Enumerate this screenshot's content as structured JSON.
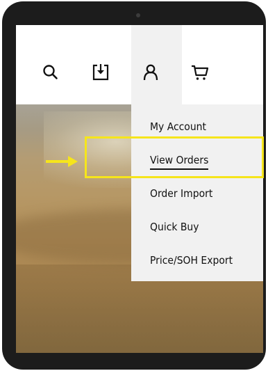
{
  "colors": {
    "accent_yellow": "#f6e51b",
    "menu_background": "#f1f1f1",
    "text": "#111111",
    "device_frame": "#1c1c1c"
  },
  "header": {
    "icons": [
      {
        "name": "search-icon"
      },
      {
        "name": "download-icon"
      },
      {
        "name": "user-icon"
      },
      {
        "name": "cart-icon"
      }
    ]
  },
  "account_menu": {
    "items": [
      {
        "label": "My Account",
        "active": false
      },
      {
        "label": "View Orders",
        "active": true
      },
      {
        "label": "Order Import",
        "active": false
      },
      {
        "label": "Quick Buy",
        "active": false
      },
      {
        "label": "Price/SOH Export",
        "active": false
      }
    ]
  },
  "annotation": {
    "highlighted_item": "View Orders"
  }
}
